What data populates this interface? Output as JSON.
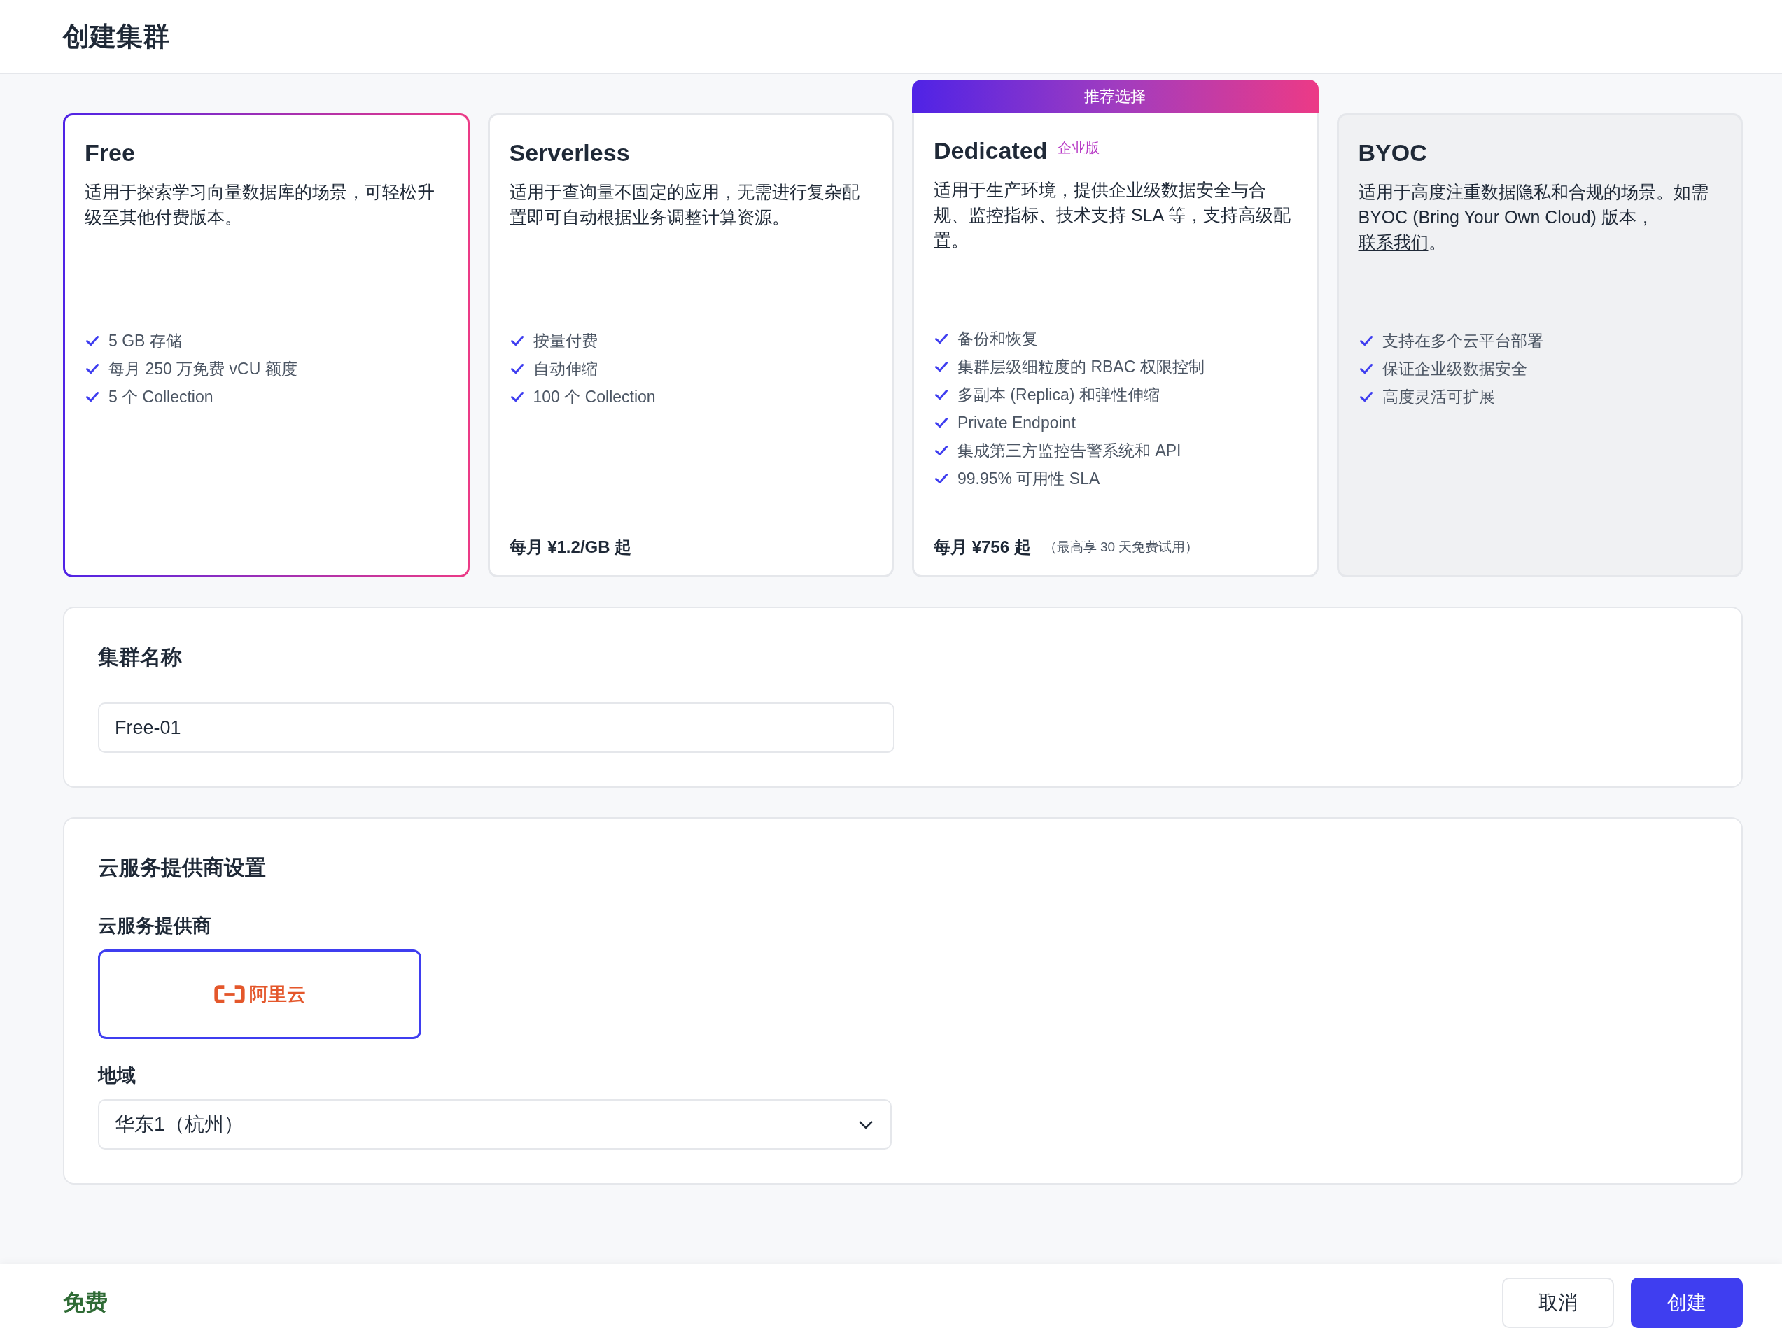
{
  "page": {
    "title": "创建集群"
  },
  "plans": [
    {
      "name": "Free",
      "selected": true,
      "disabled": false,
      "description": "适用于探索学习向量数据库的场景，可轻松升级至其他付费版本。",
      "features": [
        "5 GB 存储",
        "每月 250 万免费 vCU 额度",
        "5 个 Collection"
      ]
    },
    {
      "name": "Serverless",
      "selected": false,
      "disabled": false,
      "description": "适用于查询量不固定的应用，无需进行复杂配置即可自动根据业务调整计算资源。",
      "features": [
        "按量付费",
        "自动伸缩",
        "100 个 Collection"
      ],
      "price": "每月 ¥1.2/GB 起"
    },
    {
      "name": "Dedicated",
      "selected": false,
      "disabled": false,
      "badge": "推荐选择",
      "tag": "企业版",
      "description": "适用于生产环境，提供企业级数据安全与合规、监控指标、技术支持 SLA 等，支持高级配置。",
      "features": [
        "备份和恢复",
        "集群层级细粒度的 RBAC 权限控制",
        "多副本 (Replica) 和弹性伸缩",
        "Private Endpoint",
        "集成第三方监控告警系统和 API",
        "99.95% 可用性 SLA"
      ],
      "price": "每月 ¥756 起",
      "price_note": "（最高享 30 天免费试用）"
    },
    {
      "name": "BYOC",
      "selected": false,
      "disabled": true,
      "description": "适用于高度注重数据隐私和合规的场景。如需 BYOC (Bring Your Own Cloud) 版本，",
      "link": "联系我们",
      "description_end": "。",
      "features": [
        "支持在多个云平台部署",
        "保证企业级数据安全",
        "高度灵活可扩展"
      ]
    }
  ],
  "cluster_name": {
    "title": "集群名称",
    "value": "Free-01"
  },
  "cloud": {
    "title": "云服务提供商设置",
    "provider_label": "云服务提供商",
    "providers": [
      {
        "name": "阿里云",
        "selected": true
      }
    ],
    "region_label": "地域",
    "region": "华东1（杭州）"
  },
  "footer": {
    "price": "免费",
    "buttons": [
      {
        "label": "取消",
        "kind": "secondary"
      },
      {
        "label": "创建",
        "kind": "primary"
      }
    ]
  }
}
